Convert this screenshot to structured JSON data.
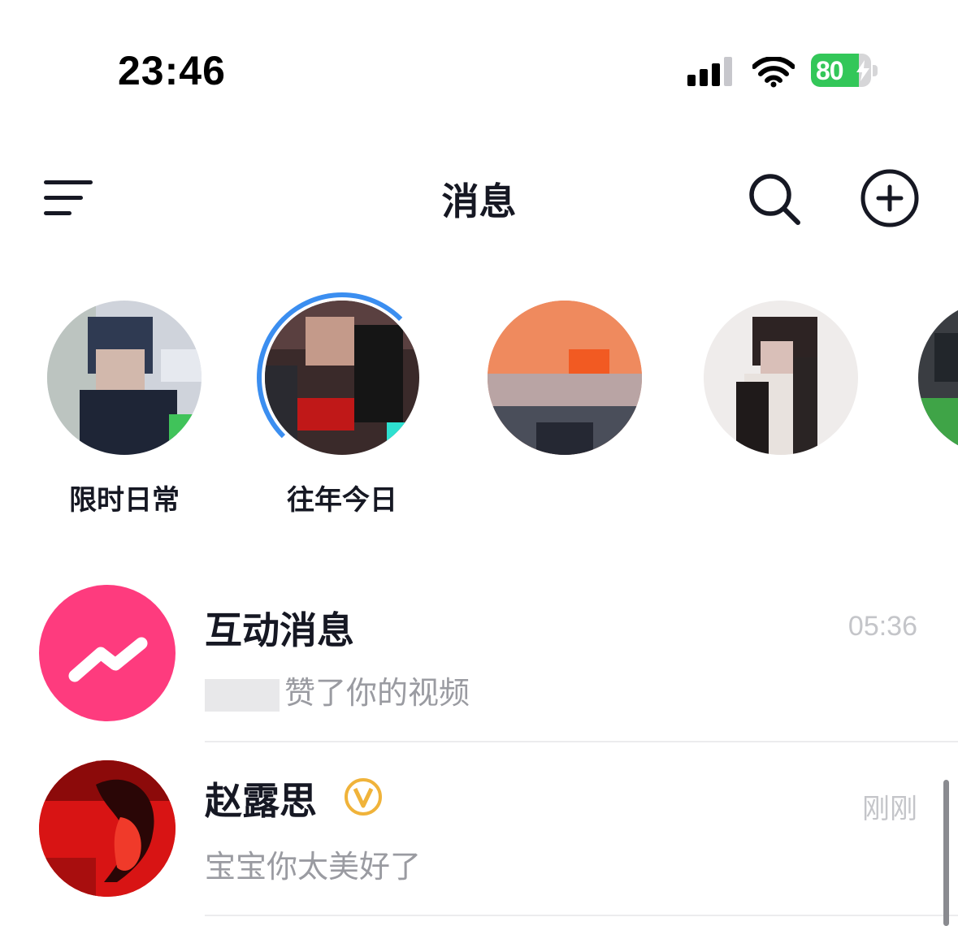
{
  "status_bar": {
    "time": "23:46",
    "battery_percent": "80",
    "battery_level": 0.8,
    "battery_color": "#33c759",
    "icons": [
      "signal-icon",
      "wifi-icon",
      "battery-icon",
      "charging-bolt-icon"
    ]
  },
  "nav": {
    "title": "消息",
    "icons": [
      "menu-icon",
      "search-icon",
      "add-circle-icon"
    ]
  },
  "stories": [
    {
      "label": "限时日常"
    },
    {
      "label": "往年今日"
    },
    {
      "label": ""
    },
    {
      "label": ""
    }
  ],
  "messages": [
    {
      "title": "互动消息",
      "preview": "赞了你的视频",
      "time": "05:36",
      "icon": "interaction-bolt-icon",
      "avatar_color": "#fe3b7e"
    },
    {
      "title": "赵露思",
      "preview": "宝宝你太美好了",
      "time": "刚刚",
      "badge": "V",
      "badge_color": "#f0b33a",
      "avatar_color": "#d81414"
    }
  ]
}
